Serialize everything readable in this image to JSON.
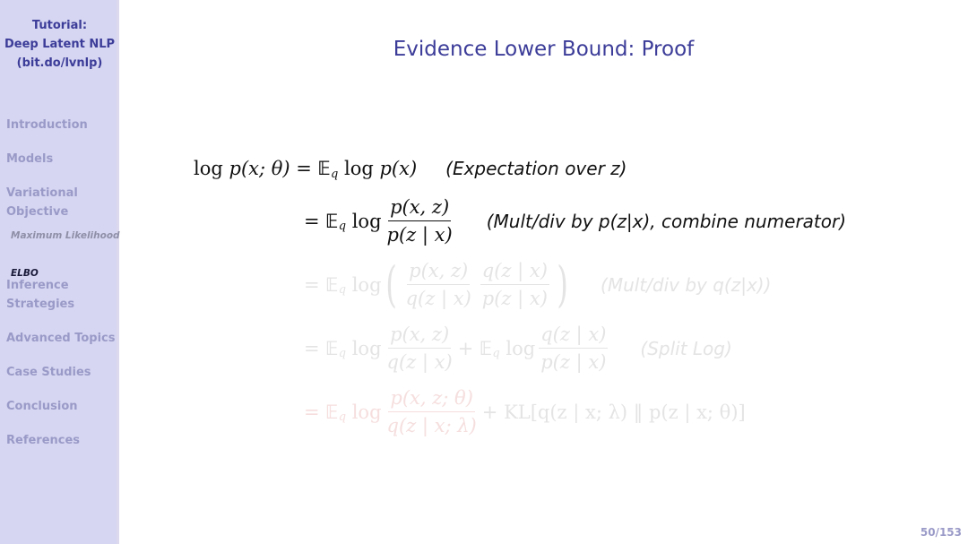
{
  "sidebar": {
    "title_lines": [
      "Tutorial:",
      "Deep Latent NLP",
      "(bit.do/lvnlp)"
    ],
    "items": [
      {
        "label": "Introduction"
      },
      {
        "label": "Models"
      },
      {
        "label_lines": [
          "Variational",
          "Objective"
        ],
        "subitems": [
          {
            "label": "Maximum Likelihood",
            "active": false
          },
          {
            "label": "ELBO",
            "active": true
          }
        ]
      },
      {
        "label_lines": [
          "Inference",
          "Strategies"
        ]
      },
      {
        "label": "Advanced Topics"
      },
      {
        "label": "Case Studies"
      },
      {
        "label": "Conclusion"
      },
      {
        "label": "References"
      }
    ]
  },
  "slide": {
    "title": "Evidence Lower Bound: Proof",
    "equations": [
      {
        "lhs": "log p(x; θ)",
        "rhs": "= 𝔼_q log p(x)",
        "note": "(Expectation over z)",
        "state": "visible"
      },
      {
        "rhs": "= 𝔼_q log p(x, z) / p(z | x)",
        "note": "(Mult/div by p(z|x), combine numerator)",
        "state": "visible"
      },
      {
        "rhs": "= 𝔼_q log ( p(x, z)/q(z | x) · q(z | x)/p(z | x) )",
        "note": "(Mult/div by q(z|x))",
        "state": "faded"
      },
      {
        "rhs": "= 𝔼_q log p(x, z)/q(z | x) + 𝔼_q log q(z | x)/p(z | x)",
        "note": "(Split Log)",
        "state": "faded"
      },
      {
        "rhs": "= 𝔼_q log p(x, z; θ)/q(z | x; λ) + KL[q(z | x; λ) ‖ p(z | x; θ)]",
        "note": "",
        "state": "faded"
      }
    ],
    "text": {
      "log": "log",
      "E": "𝔼",
      "q": "q",
      "eq": "=",
      "plus": "+",
      "lhs": "p(x; θ)",
      "px": "p(x)",
      "pxz": "p(x, z)",
      "pzx": "p(z | x)",
      "qzx": "q(z | x)",
      "pxz_theta": "p(x, z; θ)",
      "qzx_lambda": "q(z | x; λ)",
      "kl": "KL[q(z | x; λ) ‖ p(z | x; θ)]",
      "note1": "(Expectation over z)",
      "note2": "(Mult/div by p(z|x), combine numerator)",
      "note3": "(Mult/div by q(z|x))",
      "note4": "(Split Log)"
    }
  },
  "footer": {
    "page": "50/153"
  },
  "colors": {
    "sidebar_bg": "#d6d6f2",
    "title": "#3c3c99",
    "nav_inactive": "#9a9ac8",
    "highlight_faded_red": "#f6dede"
  }
}
